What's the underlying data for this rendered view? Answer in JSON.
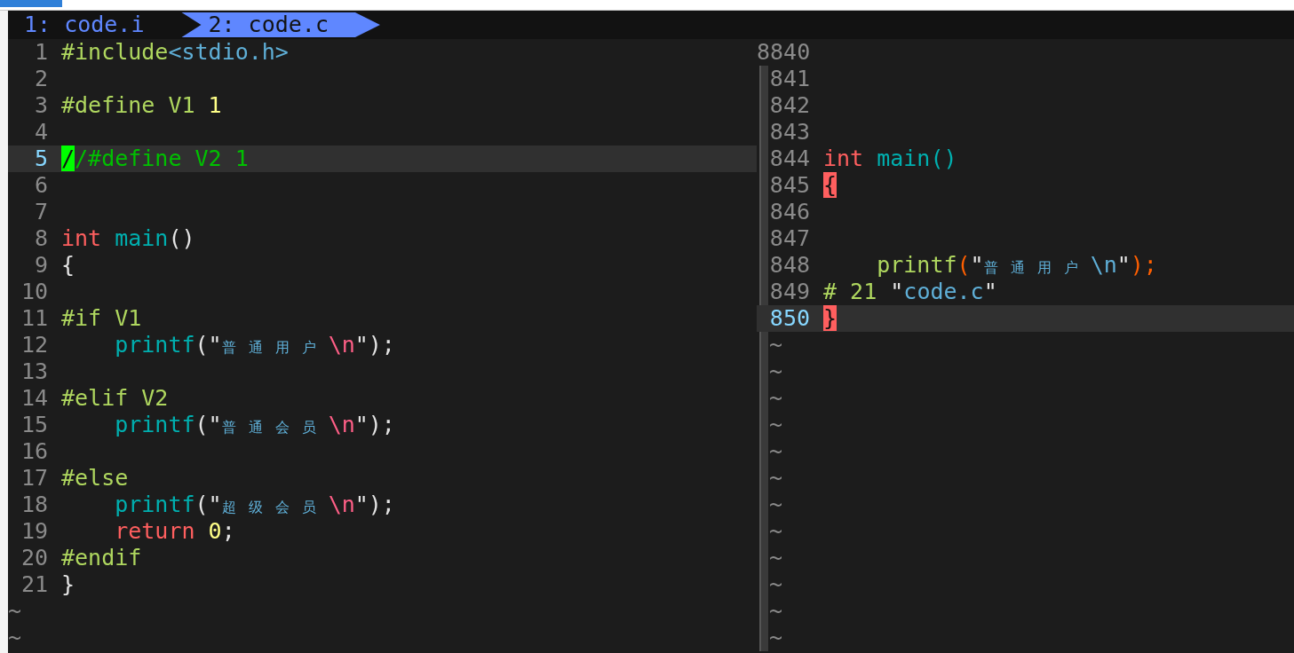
{
  "tabs": [
    {
      "label": "1: code.i",
      "selected": false
    },
    {
      "label": "2: code.c",
      "selected": true
    }
  ],
  "left_pane": {
    "lines": [
      {
        "number": "1",
        "current": false,
        "tokens": [
          {
            "text": "#include",
            "kind": "pre"
          },
          {
            "text": "<stdio.h>",
            "kind": "str"
          }
        ]
      },
      {
        "number": "2",
        "current": false
      },
      {
        "number": "3",
        "current": false,
        "tokens": [
          {
            "text": "#define V1 ",
            "kind": "pre"
          },
          {
            "text": "1",
            "kind": "num"
          }
        ]
      },
      {
        "number": "4",
        "current": false
      },
      {
        "number": "5",
        "current": true,
        "tokens": [
          {
            "text": "/",
            "kind": "cursor"
          },
          {
            "text": "/#define V2 1",
            "kind": "comment"
          }
        ]
      },
      {
        "number": "6",
        "current": false
      },
      {
        "number": "7",
        "current": false
      },
      {
        "number": "8",
        "current": false,
        "tokens": [
          {
            "text": "int ",
            "kind": "kw"
          },
          {
            "text": "main",
            "kind": "fn"
          },
          {
            "text": "()",
            "kind": "plain"
          }
        ]
      },
      {
        "number": "9",
        "current": false,
        "tokens": [
          {
            "text": "{",
            "kind": "plain"
          }
        ]
      },
      {
        "number": "10",
        "current": false
      },
      {
        "number": "11",
        "current": false,
        "tokens": [
          {
            "text": "#if V1",
            "kind": "pre"
          }
        ]
      },
      {
        "number": "12",
        "current": false,
        "tokens": [
          {
            "text": "    printf",
            "kind": "fn"
          },
          {
            "text": "(\"",
            "kind": "plain"
          },
          {
            "text": "普通用户",
            "kind": "cjk"
          },
          {
            "text": "\\n",
            "kind": "esc"
          },
          {
            "text": "\");",
            "kind": "plain"
          }
        ]
      },
      {
        "number": "13",
        "current": false
      },
      {
        "number": "14",
        "current": false,
        "tokens": [
          {
            "text": "#elif V2",
            "kind": "pre"
          }
        ]
      },
      {
        "number": "15",
        "current": false,
        "tokens": [
          {
            "text": "    printf",
            "kind": "fn"
          },
          {
            "text": "(\"",
            "kind": "plain"
          },
          {
            "text": "普通会员",
            "kind": "cjk"
          },
          {
            "text": "\\n",
            "kind": "esc"
          },
          {
            "text": "\");",
            "kind": "plain"
          }
        ]
      },
      {
        "number": "16",
        "current": false
      },
      {
        "number": "17",
        "current": false,
        "tokens": [
          {
            "text": "#else",
            "kind": "pre"
          }
        ]
      },
      {
        "number": "18",
        "current": false,
        "tokens": [
          {
            "text": "    printf",
            "kind": "fn"
          },
          {
            "text": "(\"",
            "kind": "plain"
          },
          {
            "text": "超级会员",
            "kind": "cjk"
          },
          {
            "text": "\\n",
            "kind": "esc"
          },
          {
            "text": "\");",
            "kind": "plain"
          }
        ]
      },
      {
        "number": "19",
        "current": false,
        "tokens": [
          {
            "text": "    return ",
            "kind": "kw"
          },
          {
            "text": "0",
            "kind": "num"
          },
          {
            "text": ";",
            "kind": "plain"
          }
        ]
      },
      {
        "number": "20",
        "current": false,
        "tokens": [
          {
            "text": "#endif",
            "kind": "pre"
          }
        ]
      },
      {
        "number": "21",
        "current": false,
        "tokens": [
          {
            "text": "}",
            "kind": "plain"
          }
        ]
      }
    ],
    "filler": [
      "~",
      "~"
    ]
  },
  "right_pane": {
    "lines": [
      {
        "number": "8840",
        "current": false
      },
      {
        "number": "841",
        "current": false
      },
      {
        "number": "842",
        "current": false
      },
      {
        "number": "843",
        "current": false
      },
      {
        "number": "844",
        "current": false,
        "tokens": [
          {
            "text": "int ",
            "kind": "kw"
          },
          {
            "text": "main()",
            "kind": "fn"
          }
        ]
      },
      {
        "number": "845",
        "current": false,
        "tokens": [
          {
            "text": "{",
            "kind": "match"
          }
        ]
      },
      {
        "number": "846",
        "current": false
      },
      {
        "number": "847",
        "current": false
      },
      {
        "number": "848",
        "current": false,
        "tokens": [
          {
            "text": "    printf",
            "kind": "pre"
          },
          {
            "text": "(",
            "kind": "paren"
          },
          {
            "text": "\"",
            "kind": "plain"
          },
          {
            "text": "普通用户",
            "kind": "cjk"
          },
          {
            "text": "\\n",
            "kind": "str"
          },
          {
            "text": "\"",
            "kind": "plain"
          },
          {
            "text": ");",
            "kind": "paren"
          }
        ]
      },
      {
        "number": "849",
        "current": false,
        "tokens": [
          {
            "text": "# 21 ",
            "kind": "pre"
          },
          {
            "text": "\"",
            "kind": "plain"
          },
          {
            "text": "code.c",
            "kind": "str"
          },
          {
            "text": "\"",
            "kind": "plain"
          }
        ]
      },
      {
        "number": "850",
        "current": true,
        "tokens": [
          {
            "text": "}",
            "kind": "match"
          }
        ]
      }
    ],
    "filler": [
      "~",
      "~",
      "~",
      "~",
      "~",
      "~",
      "~",
      "~",
      "~",
      "~",
      "~",
      "~"
    ]
  }
}
